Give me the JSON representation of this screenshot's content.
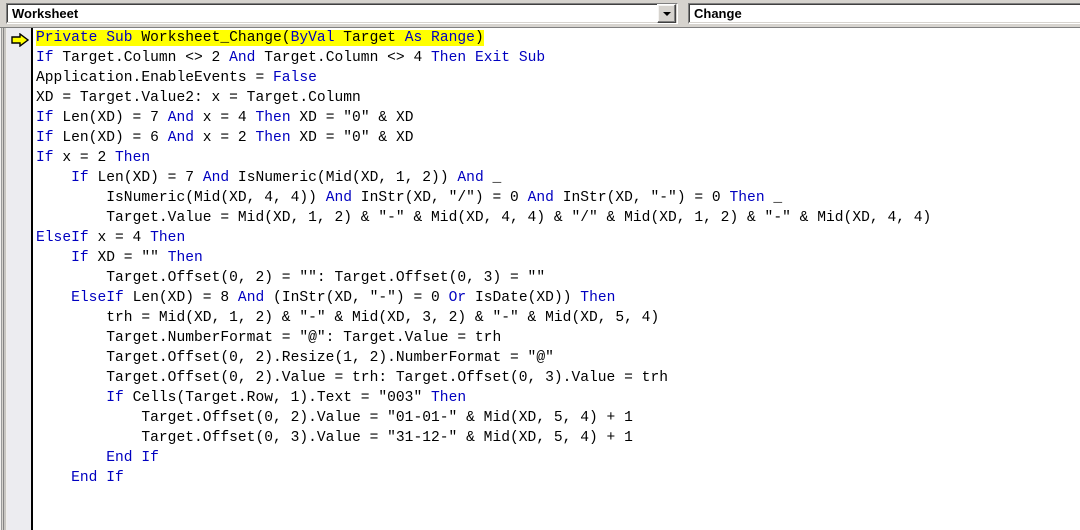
{
  "toolbar": {
    "object_combo": {
      "name": "object-dropdown",
      "value": "Worksheet",
      "icon": "chevron-down-icon"
    },
    "procedure_combo": {
      "name": "procedure-dropdown",
      "value": "Change",
      "icon": "chevron-down-icon"
    }
  },
  "margin": {
    "execution_indicator_icon": "yellow-right-arrow-icon",
    "execution_indicator_line": 1
  },
  "code": {
    "language": "VBA",
    "highlight_color": "#ffff00",
    "keyword_color": "#0000c0",
    "text_color": "#000000",
    "lines": [
      {
        "index": 1,
        "highlighted": true,
        "indent": 0,
        "tokens": [
          {
            "t": "Private",
            "k": true
          },
          {
            "t": " ",
            "k": false
          },
          {
            "t": "Sub",
            "k": true
          },
          {
            "t": " Worksheet_Change(",
            "k": false
          },
          {
            "t": "ByVal",
            "k": true
          },
          {
            "t": " Target ",
            "k": false
          },
          {
            "t": "As",
            "k": true
          },
          {
            "t": " ",
            "k": false
          },
          {
            "t": "Range",
            "k": true
          },
          {
            "t": ")",
            "k": false
          }
        ]
      },
      {
        "index": 2,
        "highlighted": false,
        "indent": 0,
        "tokens": [
          {
            "t": "If",
            "k": true
          },
          {
            "t": " Target.Column <> 2 ",
            "k": false
          },
          {
            "t": "And",
            "k": true
          },
          {
            "t": " Target.Column <> 4 ",
            "k": false
          },
          {
            "t": "Then",
            "k": true
          },
          {
            "t": " ",
            "k": false
          },
          {
            "t": "Exit",
            "k": true
          },
          {
            "t": " ",
            "k": false
          },
          {
            "t": "Sub",
            "k": true
          }
        ]
      },
      {
        "index": 3,
        "highlighted": false,
        "indent": 0,
        "tokens": [
          {
            "t": "Application.EnableEvents = ",
            "k": false
          },
          {
            "t": "False",
            "k": true
          }
        ]
      },
      {
        "index": 4,
        "highlighted": false,
        "indent": 0,
        "tokens": [
          {
            "t": "XD = Target.Value2: x = Target.Column",
            "k": false
          }
        ]
      },
      {
        "index": 5,
        "highlighted": false,
        "indent": 0,
        "tokens": [
          {
            "t": "If",
            "k": true
          },
          {
            "t": " Len(XD) = 7 ",
            "k": false
          },
          {
            "t": "And",
            "k": true
          },
          {
            "t": " x = 4 ",
            "k": false
          },
          {
            "t": "Then",
            "k": true
          },
          {
            "t": " XD = \"0\" & XD",
            "k": false
          }
        ]
      },
      {
        "index": 6,
        "highlighted": false,
        "indent": 0,
        "tokens": [
          {
            "t": "If",
            "k": true
          },
          {
            "t": " Len(XD) = 6 ",
            "k": false
          },
          {
            "t": "And",
            "k": true
          },
          {
            "t": " x = 2 ",
            "k": false
          },
          {
            "t": "Then",
            "k": true
          },
          {
            "t": " XD = \"0\" & XD",
            "k": false
          }
        ]
      },
      {
        "index": 7,
        "highlighted": false,
        "indent": 0,
        "tokens": [
          {
            "t": "If",
            "k": true
          },
          {
            "t": " x = 2 ",
            "k": false
          },
          {
            "t": "Then",
            "k": true
          }
        ]
      },
      {
        "index": 8,
        "highlighted": false,
        "indent": 4,
        "tokens": [
          {
            "t": "If",
            "k": true
          },
          {
            "t": " Len(XD) = 7 ",
            "k": false
          },
          {
            "t": "And",
            "k": true
          },
          {
            "t": " IsNumeric(Mid(XD, 1, 2)) ",
            "k": false
          },
          {
            "t": "And",
            "k": true
          },
          {
            "t": " _",
            "k": false
          }
        ]
      },
      {
        "index": 9,
        "highlighted": false,
        "indent": 8,
        "tokens": [
          {
            "t": "IsNumeric(Mid(XD, 4, 4)) ",
            "k": false
          },
          {
            "t": "And",
            "k": true
          },
          {
            "t": " InStr(XD, \"/\") = 0 ",
            "k": false
          },
          {
            "t": "And",
            "k": true
          },
          {
            "t": " InStr(XD, \"-\") = 0 ",
            "k": false
          },
          {
            "t": "Then",
            "k": true
          },
          {
            "t": " _",
            "k": false
          }
        ]
      },
      {
        "index": 10,
        "highlighted": false,
        "indent": 8,
        "tokens": [
          {
            "t": "Target.Value = Mid(XD, 1, 2) & \"-\" & Mid(XD, 4, 4) & \"/\" & Mid(XD, 1, 2) & \"-\" & Mid(XD, 4, 4)",
            "k": false
          }
        ]
      },
      {
        "index": 11,
        "highlighted": false,
        "indent": 0,
        "tokens": [
          {
            "t": "ElseIf",
            "k": true
          },
          {
            "t": " x = 4 ",
            "k": false
          },
          {
            "t": "Then",
            "k": true
          }
        ]
      },
      {
        "index": 12,
        "highlighted": false,
        "indent": 4,
        "tokens": [
          {
            "t": "If",
            "k": true
          },
          {
            "t": " XD = \"\" ",
            "k": false
          },
          {
            "t": "Then",
            "k": true
          }
        ]
      },
      {
        "index": 13,
        "highlighted": false,
        "indent": 8,
        "tokens": [
          {
            "t": "Target.Offset(0, 2) = \"\": Target.Offset(0, 3) = \"\"",
            "k": false
          }
        ]
      },
      {
        "index": 14,
        "highlighted": false,
        "indent": 4,
        "tokens": [
          {
            "t": "ElseIf",
            "k": true
          },
          {
            "t": " Len(XD) = 8 ",
            "k": false
          },
          {
            "t": "And",
            "k": true
          },
          {
            "t": " (InStr(XD, \"-\") = 0 ",
            "k": false
          },
          {
            "t": "Or",
            "k": true
          },
          {
            "t": " IsDate(XD)) ",
            "k": false
          },
          {
            "t": "Then",
            "k": true
          }
        ]
      },
      {
        "index": 15,
        "highlighted": false,
        "indent": 8,
        "tokens": [
          {
            "t": "trh = Mid(XD, 1, 2) & \"-\" & Mid(XD, 3, 2) & \"-\" & Mid(XD, 5, 4)",
            "k": false
          }
        ]
      },
      {
        "index": 16,
        "highlighted": false,
        "indent": 8,
        "tokens": [
          {
            "t": "Target.NumberFormat = \"@\": Target.Value = trh",
            "k": false
          }
        ]
      },
      {
        "index": 17,
        "highlighted": false,
        "indent": 8,
        "tokens": [
          {
            "t": "Target.Offset(0, 2).Resize(1, 2).NumberFormat = \"@\"",
            "k": false
          }
        ]
      },
      {
        "index": 18,
        "highlighted": false,
        "indent": 8,
        "tokens": [
          {
            "t": "Target.Offset(0, 2).Value = trh: Target.Offset(0, 3).Value = trh",
            "k": false
          }
        ]
      },
      {
        "index": 19,
        "highlighted": false,
        "indent": 8,
        "tokens": [
          {
            "t": "If",
            "k": true
          },
          {
            "t": " Cells(Target.Row, 1).Text = \"003\" ",
            "k": false
          },
          {
            "t": "Then",
            "k": true
          }
        ]
      },
      {
        "index": 20,
        "highlighted": false,
        "indent": 12,
        "tokens": [
          {
            "t": "Target.Offset(0, 2).Value = \"01-01-\" & Mid(XD, 5, 4) + 1",
            "k": false
          }
        ]
      },
      {
        "index": 21,
        "highlighted": false,
        "indent": 12,
        "tokens": [
          {
            "t": "Target.Offset(0, 3).Value = \"31-12-\" & Mid(XD, 5, 4) + 1",
            "k": false
          }
        ]
      },
      {
        "index": 22,
        "highlighted": false,
        "indent": 8,
        "tokens": [
          {
            "t": "End",
            "k": true
          },
          {
            "t": " ",
            "k": false
          },
          {
            "t": "If",
            "k": true
          }
        ]
      },
      {
        "index": 23,
        "highlighted": false,
        "indent": 4,
        "tokens": [
          {
            "t": "End",
            "k": true
          },
          {
            "t": " ",
            "k": false
          },
          {
            "t": "If",
            "k": true
          }
        ]
      }
    ]
  }
}
